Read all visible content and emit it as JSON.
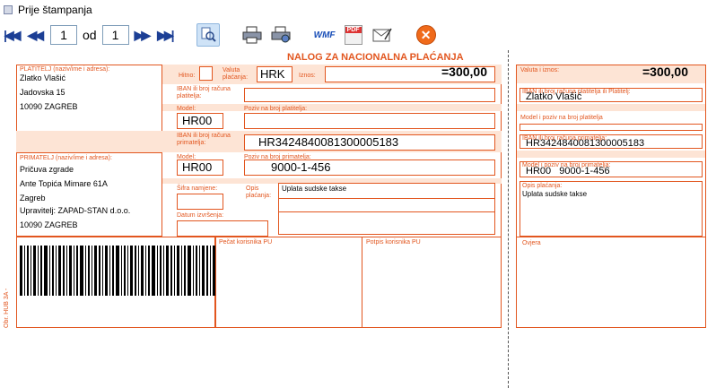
{
  "window": {
    "title": "Prije štampanja"
  },
  "toolbar": {
    "current_page": "1",
    "of_label": "od",
    "total_pages": "1",
    "first_glyph": "⏮",
    "prev_glyph": "«",
    "next_glyph": "»",
    "last_glyph": "⏭",
    "icons": [
      "first-page-icon",
      "prev-page-icon",
      "next-page-icon",
      "last-page-icon",
      "zoom-icon",
      "print-icon",
      "print-setup-icon",
      "wmf-export-icon",
      "pdf-export-icon",
      "email-icon",
      "close-icon"
    ],
    "wmf_label": "WMF",
    "pdf_label": "PDF",
    "close_glyph": "✕"
  },
  "form": {
    "title": "NALOG ZA NACIONALNA PLAĆANJA",
    "accent_color": "#e2561f",
    "payer": {
      "label": "PLATITELJ (naziv/ime i adresa):",
      "name": "Zlatko Vlašić",
      "street": "Jadovska 15",
      "city": "10090 ZAGREB"
    },
    "hitno_label": "Hitno:",
    "valuta_label": "Valuta plaćanja:",
    "currency": "HRK",
    "iznos_label": "Iznos:",
    "amount": "=300,00",
    "iban_payer_label": "IBAN ili broj računa platitelja:",
    "iban_payer": "",
    "model_label": "Model:",
    "model_payer": "HR00",
    "poziv_payer_label": "Poziv na broj platitelja:",
    "poziv_payer": "",
    "iban_recipient_label": "IBAN ili broj računa primatelja:",
    "iban_recipient": "HR3424840081300005183",
    "recipient": {
      "label": "PRIMATELJ (naziv/ime i adresa):",
      "line1": "Pričuva zgrade",
      "line2": "Ante Topića Mimare 61A",
      "line3": "Zagreb",
      "line4": "Upravitelj: ZAPAD-STAN d.o.o.",
      "line5": "10090 ZAGREB"
    },
    "model_recipient_label": "Model:",
    "model_recipient": "HR00",
    "poziv_recipient_label": "Poziv na broj primatelja:",
    "poziv_recipient": "9000-1-456",
    "sifra_label": "Šifra namjene:",
    "opis_label": "Opis plaćanja:",
    "opis": "Uplata sudske takse",
    "datum_label": "Datum izvršenja:",
    "pecat_label": "Pečat korisnika PU",
    "potpis_label": "Potpis korisnika PU",
    "side_label": "Obr. HUB 3A -",
    "receipt": {
      "valuta_iznos_label": "Valuta i iznos:",
      "amount": "=300,00",
      "iban_payer_label": "IBAN ili broj računa platitelja ili Platitelj:",
      "payer_name": "Zlatko Vlašić",
      "model_poziv_payer_label": "Model i poziv na broj platitelja",
      "model_poziv_payer": "",
      "iban_recipient_label": "IBAN ili broj računa primatelja:",
      "iban_recipient": "HR3424840081300005183",
      "model_poziv_recipient_label": "Model i poziv na broj primatelja:",
      "model_poziv_recipient": "HR00   9000-1-456",
      "opis_label": "Opis plaćanja:",
      "opis": "Uplata sudske takse",
      "ovjera_label": "Ovjera"
    }
  }
}
